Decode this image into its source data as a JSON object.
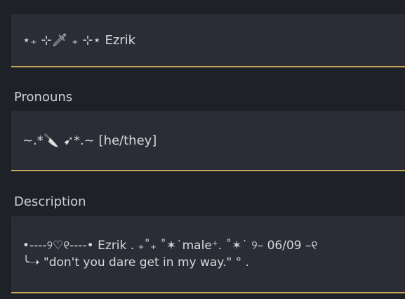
{
  "name_field": {
    "value": "⋆₊ ⊹🗡 ₊ ⊹⋆ Ezrik"
  },
  "pronouns": {
    "label": "Pronouns",
    "value": "~.*🔪 ➹*.~ [he/they]"
  },
  "description": {
    "label": "Description",
    "line1": "•----୨♡୧----• Ezrik . ₊˚₊ ˚✶˙male⁺. ˚✶˙ ୨– 06/09 –୧",
    "line2": "╰➝ \"don't you dare get in my way.\" ° ."
  },
  "colors": {
    "background": "#1f2128",
    "field_bg": "#2b2d36",
    "accent_underline": "#c9a45a"
  }
}
